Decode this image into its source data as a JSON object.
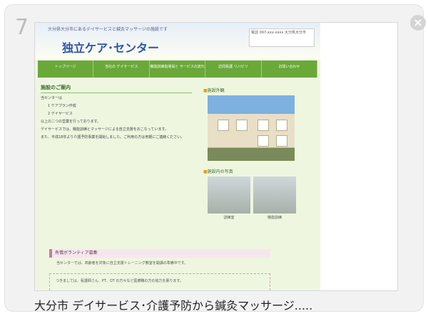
{
  "card": {
    "number": "7",
    "close_symbol": "×",
    "caption": "大分市 デイサービス･介護予防から鍼灸マッサージ....."
  },
  "website": {
    "header": {
      "subtitle": "大分県大分市にあるデイサービスと鍼灸マッサージの施設です",
      "title": "独立ケア･センター",
      "contact": "電話 097-xxx-xxxx 大分県大分市"
    },
    "nav": [
      {
        "label": "トップページ"
      },
      {
        "label": "当社の デイサービス"
      },
      {
        "label": "機能訓練指導員と サービスの流れ"
      },
      {
        "label": "訪問看護 リハビリ"
      },
      {
        "label": "お問い合わせ"
      }
    ],
    "section_heading": "施設のご案内",
    "intro_label": "当センターは",
    "items": [
      "1 ケアプラン作成",
      "2 デイサービス"
    ],
    "paragraphs": [
      "以上の二つの営業を行っております。",
      "デイサービスでは、機能訓練とマッサージによる自立支援をおこなっています。",
      "また、平成18年より介護予防事業を開始しました。ご利用の方は気軽にご連絡ください。"
    ],
    "photo_heading_1": "施設外観",
    "photo_heading_2": "施設内の写真",
    "photo_captions": [
      "訓練室",
      "機能訓練"
    ],
    "volunteer_heading": "有償ボランティア募集",
    "volunteer_text": "当センターでは、高齢者を対象に自立支援トレーニング教室を開講の準備中です。",
    "dashed_text": "つきましては、看護師さん、PT、OT の方々など医療職の方の協力を募ります。"
  }
}
